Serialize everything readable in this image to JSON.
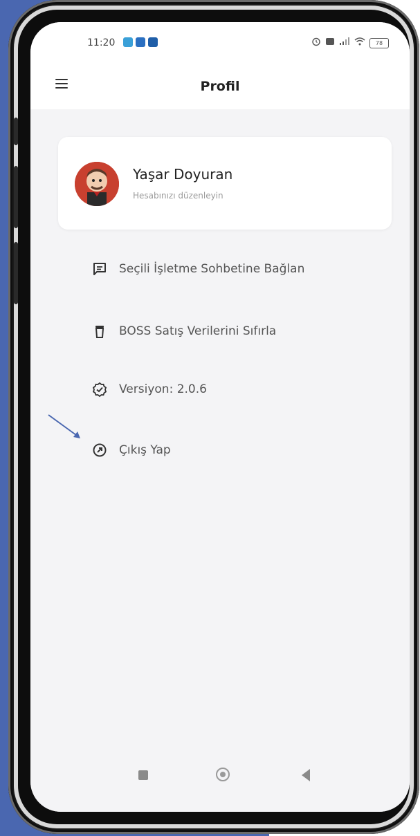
{
  "status_bar": {
    "time": "11:20",
    "battery_level": "78",
    "icons_left": [
      "chat-app-icon",
      "linkedin-icon",
      "messaging-icon"
    ],
    "icons_right": [
      "alarm-icon",
      "nfc-icon",
      "signal-icon",
      "wifi-icon",
      "battery-icon"
    ]
  },
  "app_bar": {
    "title": "Profil",
    "menu_icon": "hamburger-menu-icon"
  },
  "profile_card": {
    "name": "Yaşar Doyuran",
    "subtitle": "Hesabınızı düzenleyin"
  },
  "menu": {
    "items": [
      {
        "label": "Seçili İşletme Sohbetine Bağlan",
        "icon": "chat-bubble-icon"
      },
      {
        "label": "BOSS Satış Verilerini Sıfırla",
        "icon": "trash-icon"
      },
      {
        "label": "Versiyon: 2.0.6",
        "icon": "verified-badge-icon"
      },
      {
        "label": "Çıkış Yap",
        "icon": "exit-arrow-icon"
      }
    ]
  },
  "nav_bar": {
    "buttons": [
      "recents-button",
      "home-button",
      "back-button"
    ]
  },
  "colors": {
    "background": "#4a67b0",
    "screen_bg": "#f4f4f6",
    "card_bg": "#ffffff",
    "text_primary": "#222222",
    "text_secondary": "#555555",
    "text_muted": "#9a9a9a",
    "annotation_arrow": "#4a67b0"
  }
}
